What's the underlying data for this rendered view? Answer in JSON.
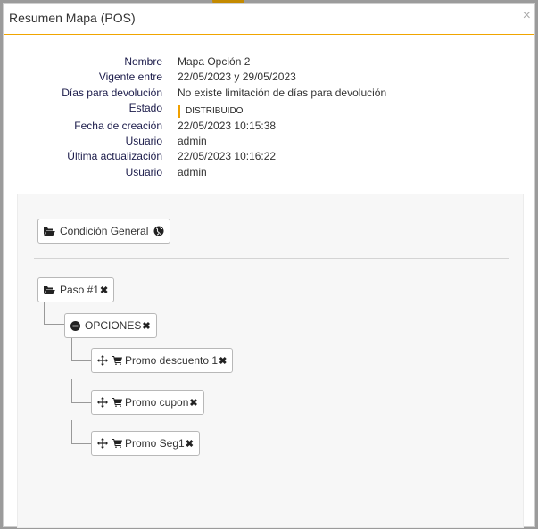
{
  "modal": {
    "title": "Resumen Mapa (POS)",
    "close": "×"
  },
  "info": {
    "nombre_label": "Nombre",
    "nombre_value": "Mapa Opción 2",
    "vigente_label": "Vigente entre",
    "vigente_value": "22/05/2023 y 29/05/2023",
    "dias_label": "Días para devolución",
    "dias_value": "No existe limitación de días para devolución",
    "estado_label": "Estado",
    "estado_value": "DISTRIBUIDO",
    "fecha_label": "Fecha de creación",
    "fecha_value": "22/05/2023 10:15:38",
    "usuario1_label": "Usuario",
    "usuario1_value": "admin",
    "ultima_label": "Última actualización",
    "ultima_value": "22/05/2023 10:16:22",
    "usuario2_label": "Usuario",
    "usuario2_value": "admin"
  },
  "tree": {
    "general": "Condición General",
    "paso": "Paso #1",
    "opciones": "OPCIONES",
    "promo1": "Promo descuento 1",
    "promo2": "Promo cupon",
    "promo3": "Promo Seg1",
    "remove": "✖"
  },
  "colors": {
    "accent": "#f0a500",
    "label": "#1b1b4a"
  }
}
